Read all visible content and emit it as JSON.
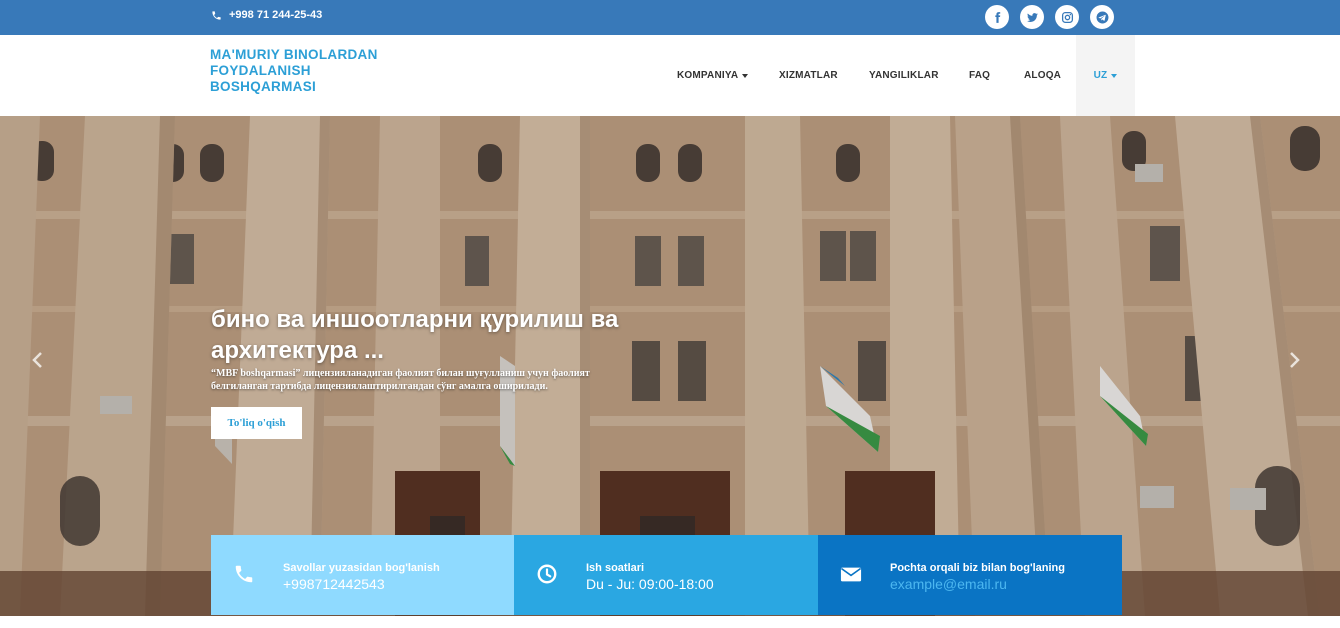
{
  "topbar": {
    "phone": "+998 71 244-25-43",
    "socials": [
      {
        "icon": "facebook-icon"
      },
      {
        "icon": "twitter-icon"
      },
      {
        "icon": "instagram-icon"
      },
      {
        "icon": "telegram-icon"
      }
    ],
    "color": "#3879b9"
  },
  "header": {
    "logo_lines": [
      "MA'MURIY BINOLARDAN",
      "FOYDALANISH",
      "BOSHQARMASI"
    ],
    "nav": [
      {
        "label": "KOMPANIYA",
        "dropdown": true
      },
      {
        "label": "XIZMATLAR"
      },
      {
        "label": "YANGILIKLAR"
      },
      {
        "label": "FAQ"
      },
      {
        "label": "ALOQA"
      }
    ],
    "lang": "UZ"
  },
  "hero": {
    "title": "бино ва иншоотларни қурилиш ва архитектура ...",
    "text": "“MBF boshqarmasi” лицензияланадиган фаолият билан шуғулланиш учун фаолият белгиланган тартибда лицензиялаштирилгандан сўнг амалга оширилади.",
    "button": "To'liq o'qish"
  },
  "info_boxes": [
    {
      "icon": "phone-icon",
      "label": "Savollar yuzasidan bog'lanish",
      "value": "+998712442543",
      "color": "#8fdaff"
    },
    {
      "icon": "clock-icon",
      "label": "Ish soatlari",
      "value": "Du - Ju: 09:00-18:00",
      "color": "#2aa7e2"
    },
    {
      "icon": "envelope-icon",
      "label": "Pochta orqali biz bilan bog'laning",
      "value": "example@email.ru",
      "color": "#0a74c4"
    }
  ]
}
